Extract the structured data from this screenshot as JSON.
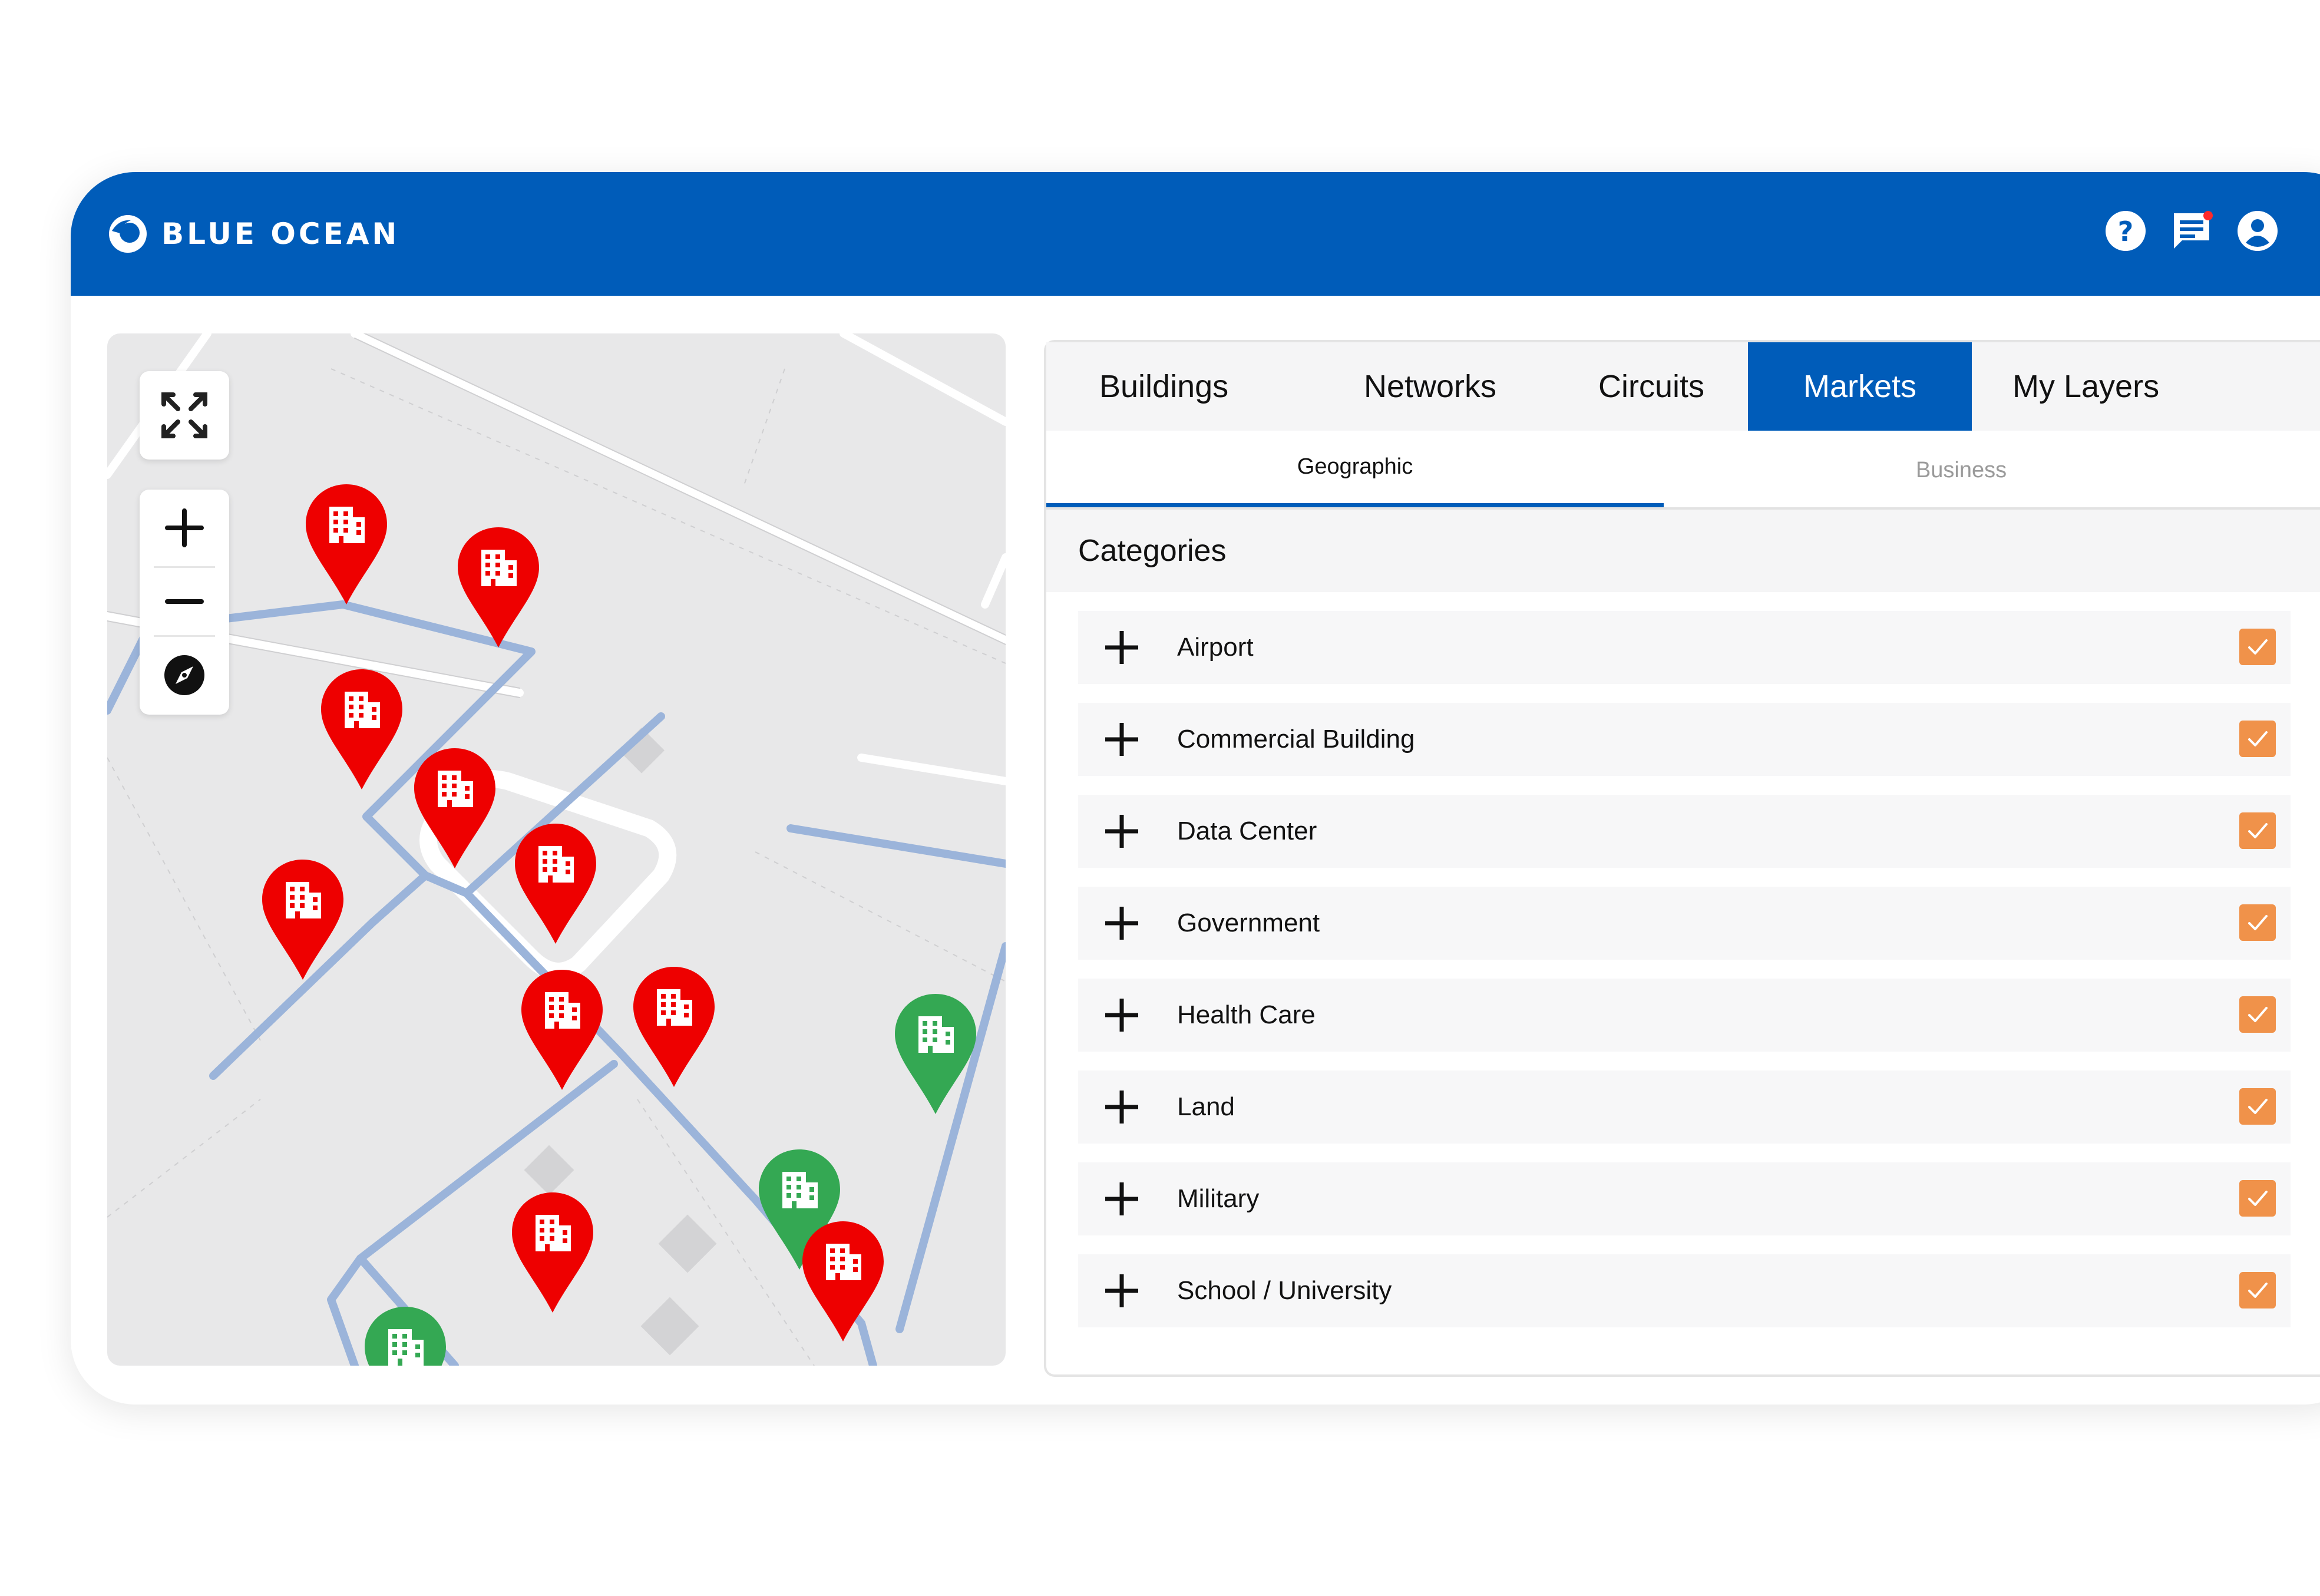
{
  "brand": {
    "name": "BLUE OCEAN",
    "color": "#005cb9"
  },
  "header_icons": [
    "help-icon",
    "messages-icon",
    "account-icon"
  ],
  "map": {
    "controls": [
      "fullscreen-icon",
      "zoom-in-icon",
      "zoom-out-icon",
      "compass-icon"
    ],
    "pin_colors": {
      "red": "#ee0000",
      "green": "#34a853"
    }
  },
  "tabs": [
    {
      "label": "Buildings"
    },
    {
      "label": "Networks"
    },
    {
      "label": "Circuits"
    },
    {
      "label": "Markets",
      "active": true
    },
    {
      "label": "My Layers"
    }
  ],
  "subtabs": [
    {
      "label": "Geographic",
      "active": true
    },
    {
      "label": "Business"
    }
  ],
  "categories": {
    "title": "Categories",
    "items": [
      {
        "label": "Airport",
        "checked": true
      },
      {
        "label": "Commercial Building",
        "checked": true
      },
      {
        "label": "Data Center",
        "checked": true
      },
      {
        "label": "Government",
        "checked": true
      },
      {
        "label": "Health Care",
        "checked": true
      },
      {
        "label": "Land",
        "checked": true
      },
      {
        "label": "Military",
        "checked": true
      },
      {
        "label": "School / University",
        "checked": true
      }
    ]
  },
  "checkbox_color": "#f0924a"
}
